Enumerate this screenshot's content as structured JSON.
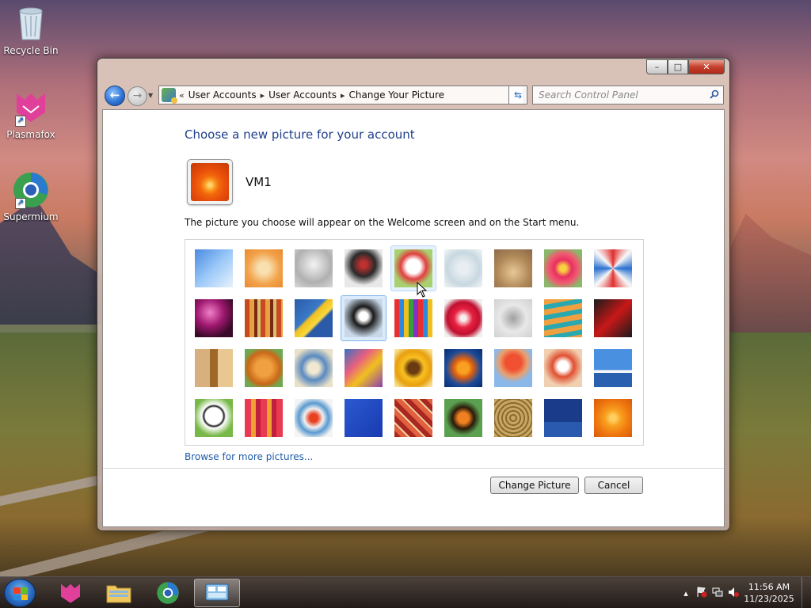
{
  "desktop": {
    "icons": [
      {
        "label": "Recycle Bin"
      },
      {
        "label": "Plasmafox"
      },
      {
        "label": "Supermium"
      }
    ]
  },
  "window": {
    "controls": {
      "minimize": "–",
      "maximize": "□",
      "close": "✕"
    },
    "nav": {
      "back": "←",
      "forward": "→"
    },
    "address": {
      "overflow": "«",
      "crumbs": [
        "User Accounts",
        "User Accounts",
        "Change Your Picture"
      ],
      "separator": "▸"
    },
    "search": {
      "placeholder": "Search Control Panel"
    },
    "heading": "Choose a new picture for your account",
    "username": "VM1",
    "description": "The picture you choose will appear on the Welcome screen and on the Start menu.",
    "browse_link": "Browse for more pictures...",
    "buttons": {
      "change": "Change Picture",
      "cancel": "Cancel"
    },
    "pictures": [
      {
        "name": "rollercoaster",
        "bg": "linear-gradient(135deg,#4a8ae0,#9ac8f8 50%,#e8f2fc)"
      },
      {
        "name": "starfish",
        "bg": "radial-gradient(circle,#f8e0b0 20%,#f2a24a 60%,#e88a30)"
      },
      {
        "name": "robot-toy",
        "bg": "radial-gradient(circle at 50% 40%,#f4f4f4,#b0b0b0 60%,#d8d8d8)"
      },
      {
        "name": "turntable",
        "bg": "radial-gradient(circle at 50% 40%,#c03030 10%,#2a2a2a 40%,#e8e8e8 70%)"
      },
      {
        "name": "lucky-cat",
        "bg": "radial-gradient(circle at 50% 45%,#ffffff 25%,#e04040 45%,#a8d070 70%)"
      },
      {
        "name": "gyroscope",
        "bg": "radial-gradient(circle,#e8eef2 20%,#c8d8e0 60%,#f2f6f8)"
      },
      {
        "name": "kitten",
        "bg": "radial-gradient(circle at 50% 60%,#e8c898,#b08858 55%,#8a6848)"
      },
      {
        "name": "pink-flower",
        "bg": "radial-gradient(circle,#f8d040 12%,#e83060 32%,#f05a70 55%,#8ab86a 80%)"
      },
      {
        "name": "pinwheel",
        "bg": "conic-gradient(#e03030,#f8f8f8,#2a70d0,#f8f8f8,#e03030,#f8f8f8,#2a70d0,#f8f8f8,#e03030)"
      },
      {
        "name": "ball-purple",
        "bg": "radial-gradient(circle at 40% 35%,#f080c8,#a01870 40%,#3a0a2a 75%)"
      },
      {
        "name": "fabric",
        "bg": "repeating-linear-gradient(90deg,#c84a20 0 6px,#e8a040 6px 12px,#7a2a10 12px 16px,#d8c070 16px 20px)"
      },
      {
        "name": "leaf",
        "bg": "linear-gradient(135deg,#2a5aa8,#3a7ac8 40%,#f0c020 45%,#f8d840 60%,#2a5aa8 65%)"
      },
      {
        "name": "dog",
        "bg": "radial-gradient(circle at 50% 45%,#ffffff 15%,#1a1a1a 35%,#c8d8e8 75%)"
      },
      {
        "name": "crayons",
        "bg": "repeating-linear-gradient(90deg,#e83030 0 6px,#2a8ae0 6px 12px,#f0c020 12px 18px,#30a040 18px 24px,#8a30c0 24px 30px)"
      },
      {
        "name": "red-star",
        "bg": "radial-gradient(circle,#f8f0f0 10%,#e82040 35%,#c01030 60%,#f0f0f0 85%)"
      },
      {
        "name": "jacks",
        "bg": "radial-gradient(circle,#a0a0a0,#e8e8e8 50%,#d0d0d0)"
      },
      {
        "name": "stairs",
        "bg": "repeating-linear-gradient(170deg,#f0a040 0 7px,#2aa8b0 7px 13px)"
      },
      {
        "name": "origami-crane",
        "bg": "linear-gradient(135deg,#1a1a1a,#c81818 50%,#1a1a1a)"
      },
      {
        "name": "guitar",
        "bg": "linear-gradient(90deg,#d8b080 0 40%,#a06828 40% 60%,#e8c890 60%)"
      },
      {
        "name": "pomeranian",
        "bg": "radial-gradient(circle at 50% 50%,#f0a040 30%,#c86818 60%,#70a850 80%)"
      },
      {
        "name": "robot-tin",
        "bg": "radial-gradient(circle,#f0e8d0 20%,#5a8ac0 45%,#e8e0c8 80%)"
      },
      {
        "name": "scarves",
        "bg": "linear-gradient(135deg,#3a70c0,#e86080 35%,#f0c020 60%,#8a40b0)"
      },
      {
        "name": "sunflower",
        "bg": "radial-gradient(circle,#6a3a10 20%,#f8c020 40%,#e8a010 65%,#f8e090 90%)"
      },
      {
        "name": "fish",
        "bg": "radial-gradient(circle,#f8a020 20%,#e06010 35%,#1a4a9a 65%,#0a2a6a)"
      },
      {
        "name": "balloon",
        "bg": "radial-gradient(circle at 50% 35%,#f05030 25%,#e8a070 45%,#8ab8e8 65%)"
      },
      {
        "name": "daruma",
        "bg": "radial-gradient(circle at 50% 45%,#ffffff 18%,#e05030 38%,#f0d0b0 70%)"
      },
      {
        "name": "sailboat",
        "bg": "linear-gradient(180deg,#4a90e0 0 55%,#f8f8f8 55% 62%,#2a60b0 62%)"
      },
      {
        "name": "soccer-ball",
        "bg": "radial-gradient(circle at 50% 45%,#ffffff 30%,#1a1a1a 36%,#ffffff 42%,#78b848 70%)"
      },
      {
        "name": "stripes",
        "bg": "repeating-linear-gradient(90deg,#e83a50 0 8px,#f0a030 8px 14px,#c02040 14px 20px)"
      },
      {
        "name": "marbles",
        "bg": "radial-gradient(circle at 50% 50%,#e84020 15%,#f0f0f0 35%,#5a9ad0 55%,#f4f4f4 80%)"
      },
      {
        "name": "window",
        "bg": "linear-gradient(135deg,#2a5ad0,#1a3ab0)"
      },
      {
        "name": "textile",
        "bg": "repeating-linear-gradient(45deg,#a82820 0 6px,#e06040 6px 12px,#f0d0a0 12px 14px)"
      },
      {
        "name": "butterfly",
        "bg": "radial-gradient(circle,#f08020 20%,#2a1a0a 40%,#5aa050 65%)"
      },
      {
        "name": "shell",
        "bg": "repeating-radial-gradient(circle,#c8a860 0 3px,#8a6a30 3px 5px)"
      },
      {
        "name": "lighthouse",
        "bg": "linear-gradient(180deg,#1a3a8a 0 60%,#2a5ab0 60%)"
      },
      {
        "name": "orange-flower",
        "bg": "radial-gradient(circle,#ffd060 10%,#f8a020 30%,#f07a10 60%,#d85a08)"
      }
    ]
  },
  "taskbar": {
    "clock": {
      "time": "11:56 AM",
      "date": "11/23/2025"
    },
    "tray": {
      "arrow": "▴"
    }
  }
}
